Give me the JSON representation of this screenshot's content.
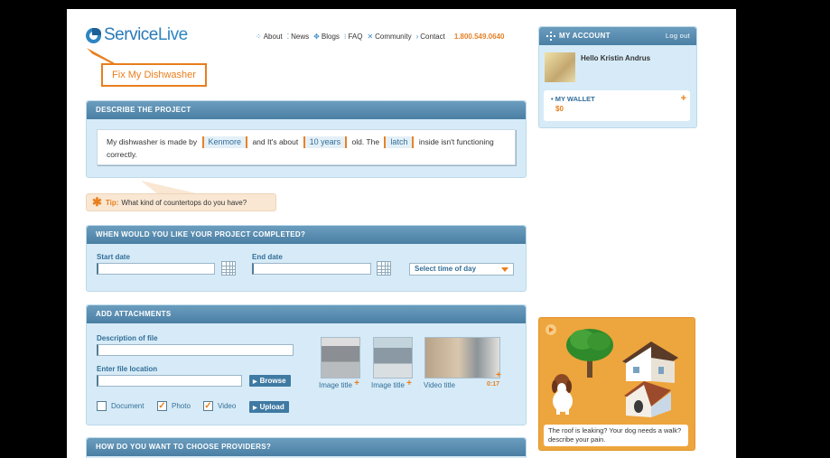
{
  "brand": {
    "name_part1": "Service",
    "name_part2": "Live"
  },
  "nav": {
    "items": [
      {
        "label": "About",
        "icon": "grid-icon"
      },
      {
        "label": "News",
        "icon": "dots-icon"
      },
      {
        "label": "Blogs",
        "icon": "diamond-icon"
      },
      {
        "label": "FAQ",
        "icon": "faq-icon"
      },
      {
        "label": "Community",
        "icon": "cross-icon"
      },
      {
        "label": "Contact",
        "icon": "arrow-icon"
      }
    ],
    "phone": "1.800.549.0640"
  },
  "callout": {
    "text": "Fix My Dishwasher"
  },
  "describe": {
    "heading": "DESCRIBE THE PROJECT",
    "s1": "My dishwasher is made by",
    "brand_value": "Kenmore",
    "s2": "and It's about",
    "age_value": "10 years",
    "s3": "old.  The",
    "part_value": "latch",
    "s4": "inside isn't functioning correctly."
  },
  "tip": {
    "label": "Tip:",
    "text": "What kind of countertops do you have?"
  },
  "schedule": {
    "heading": "WHEN WOULD YOU LIKE YOUR PROJECT COMPLETED?",
    "start_label": "Start date",
    "end_label": "End date",
    "time_select": "Select time of day"
  },
  "attachments": {
    "heading": "ADD ATTACHMENTS",
    "desc_label": "Description of file",
    "location_label": "Enter file location",
    "browse_label": "Browse",
    "upload_label": "Upload",
    "checkboxes": [
      {
        "label": "Document",
        "checked": false
      },
      {
        "label": "Photo",
        "checked": true
      },
      {
        "label": "Video",
        "checked": true
      }
    ],
    "thumbs": [
      {
        "caption": "Image title"
      },
      {
        "caption": "Image title"
      },
      {
        "caption": "Video title",
        "duration": "0:17"
      }
    ]
  },
  "providers": {
    "heading": "HOW DO YOU WANT TO CHOOSE PROVIDERS?"
  },
  "account": {
    "heading": "MY ACCOUNT",
    "logout": "Log out",
    "greeting": "Hello Kristin Andrus",
    "wallet_label": "MY WALLET",
    "wallet_value": "$0"
  },
  "promo": {
    "text": "The roof is leaking? Your dog needs a walk? describe your pain."
  },
  "colors": {
    "accent": "#e97e1c",
    "panel_head": "#4f86ab",
    "panel_bg": "#d6ebf7",
    "promo_bg": "#eda53d"
  }
}
